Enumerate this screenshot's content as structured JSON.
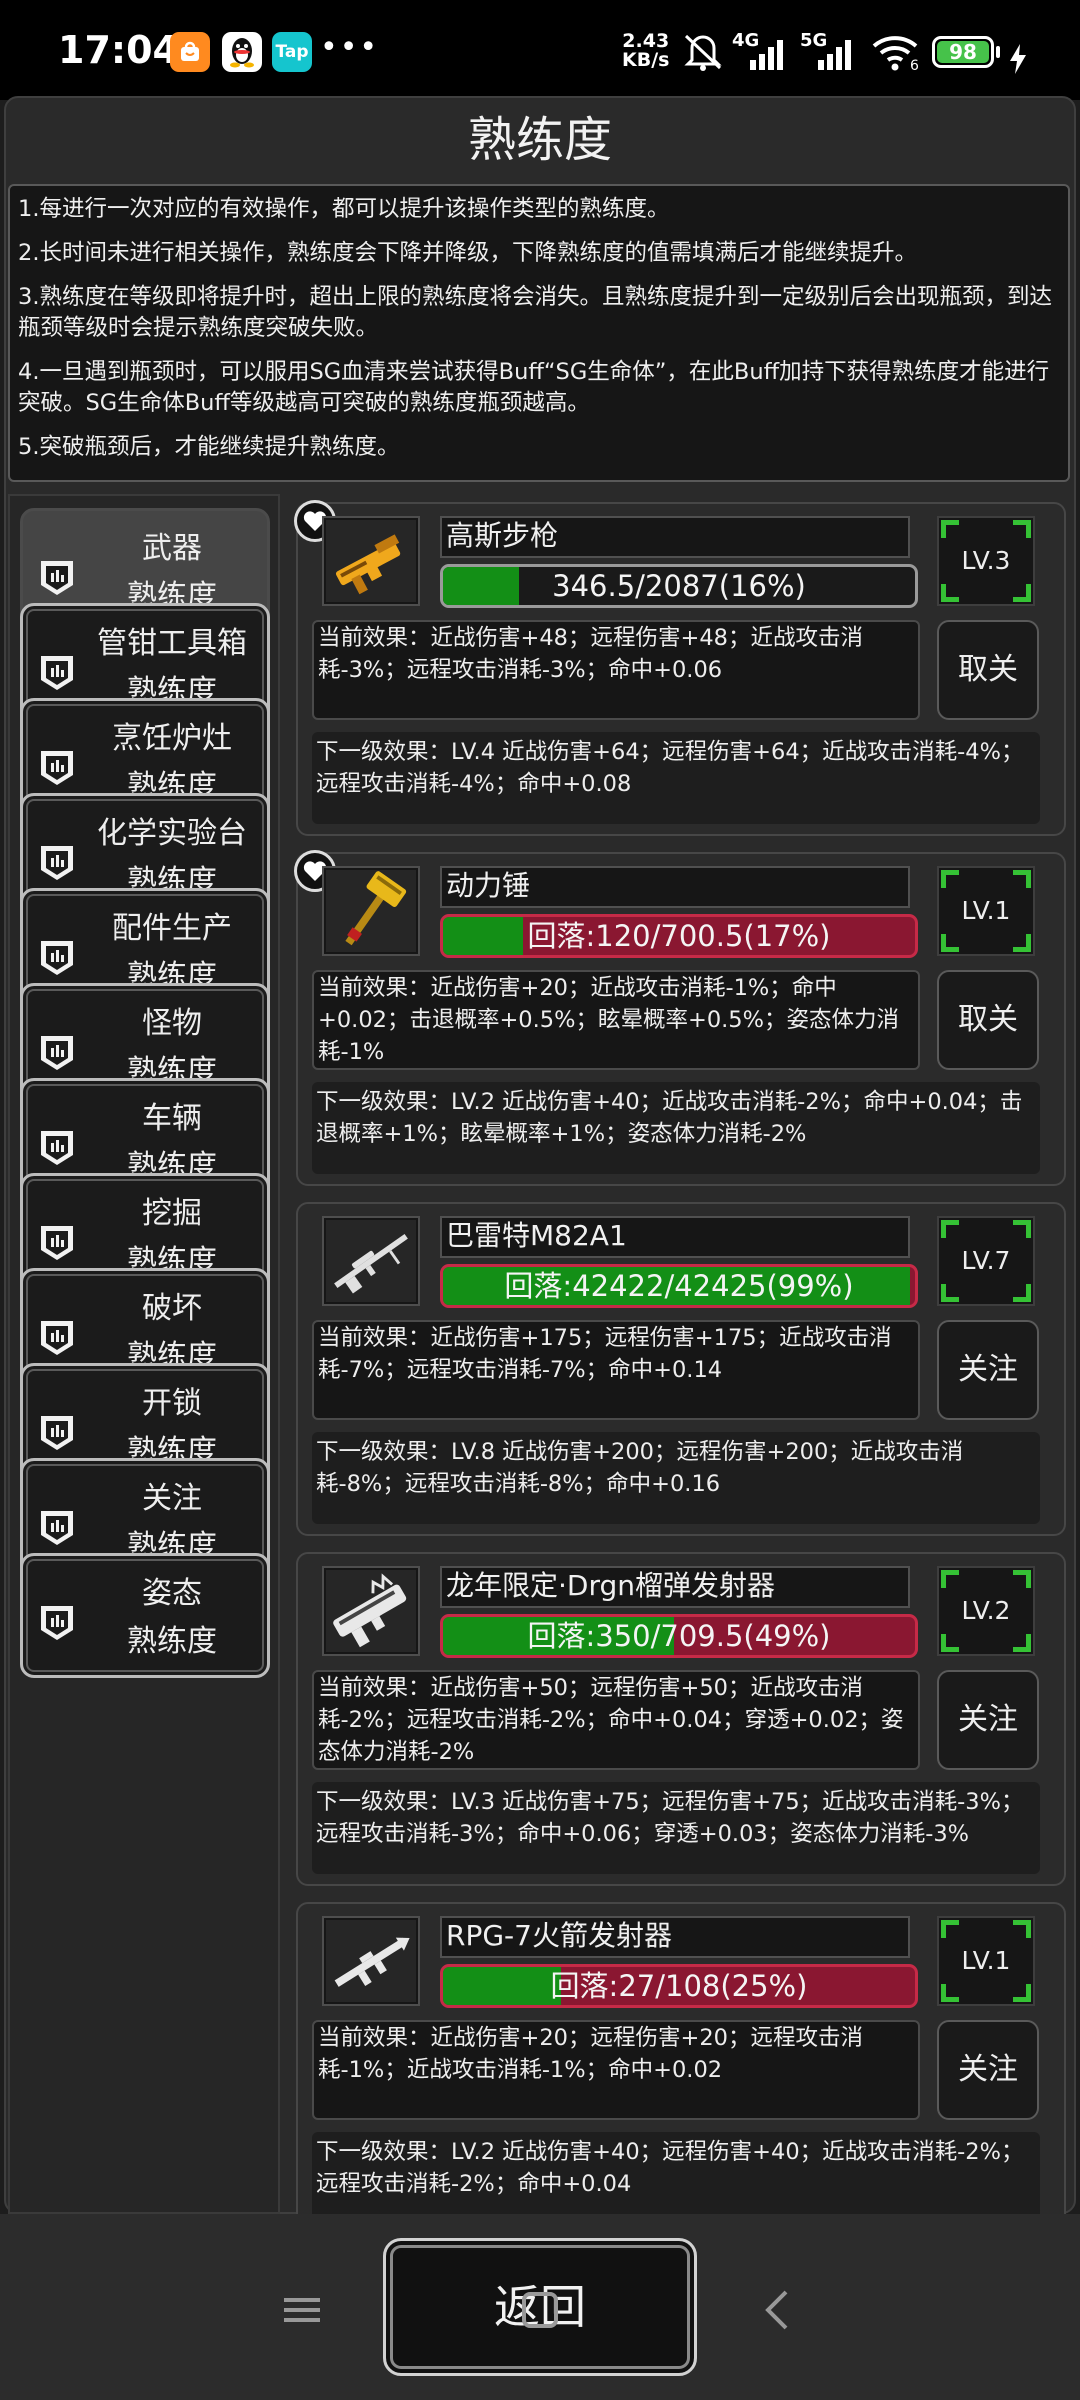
{
  "status_bar": {
    "time": "17:04",
    "app_icons": [
      {
        "name": "mi-store-icon",
        "color": "#ff8a1f",
        "glyph": "🛒"
      },
      {
        "name": "qq-icon",
        "color": "#ffffff",
        "glyph": "🐧"
      },
      {
        "name": "taptap-icon",
        "color": "#15c5ce",
        "glyph": "Tap"
      }
    ],
    "more": "•••",
    "speed_value": "2.43",
    "speed_unit": "KB/s",
    "network_4g": "4G",
    "network_5g": "5G",
    "battery": "98"
  },
  "title": "熟练度",
  "notes": [
    "1.每进行一次对应的有效操作，都可以提升该操作类型的熟练度。",
    "2.长时间未进行相关操作，熟练度会下降并降级，下降熟练度的值需填满后才能继续提升。",
    "3.熟练度在等级即将提升时，超出上限的熟练度将会消失。且熟练度提升到一定级别后会出现瓶颈，到达瓶颈等级时会提示熟练度突破失败。",
    "4.一旦遇到瓶颈时，可以服用SG血清来尝试获得Buff“SG生命体”，在此Buff加持下获得熟练度才能进行突破。SG生命体Buff等级越高可突破的熟练度瓶颈越高。",
    "5.突破瓶颈后，才能继续提升熟练度。"
  ],
  "categories": [
    {
      "name": "武器",
      "suffix": "熟练度",
      "active": true
    },
    {
      "name": "管钳工具箱",
      "suffix": "熟练度"
    },
    {
      "name": "烹饪炉灶",
      "suffix": "熟练度"
    },
    {
      "name": "化学实验台",
      "suffix": "熟练度"
    },
    {
      "name": "配件生产",
      "suffix": "熟练度"
    },
    {
      "name": "怪物",
      "suffix": "熟练度"
    },
    {
      "name": "车辆",
      "suffix": "熟练度"
    },
    {
      "name": "挖掘",
      "suffix": "熟练度"
    },
    {
      "name": "破坏",
      "suffix": "熟练度"
    },
    {
      "name": "开锁",
      "suffix": "熟练度"
    },
    {
      "name": "关注",
      "suffix": "熟练度"
    },
    {
      "name": "姿态",
      "suffix": "熟练度"
    }
  ],
  "weapons": [
    {
      "name": "高斯步枪",
      "progress_text": "346.5/2087(16%)",
      "progress": 0.16,
      "bar_state": "normal",
      "level": "LV.3",
      "favorite": true,
      "current": "当前效果：近战伤害+48；远程伤害+48；近战攻击消耗-3%；远程攻击消耗-3%；命中+0.06",
      "action": "取关",
      "next": "下一级效果：LV.4 近战伤害+64；远程伤害+64；近战攻击消耗-4%；远程攻击消耗-4%；命中+0.08",
      "icon": "gauss-rifle-icon",
      "icon_color": "#f0a81c"
    },
    {
      "name": "动力锤",
      "progress_text": "回落:120/700.5(17%)",
      "progress": 0.17,
      "bar_state": "decline",
      "level": "LV.1",
      "favorite": true,
      "current": "当前效果：近战伤害+20；近战攻击消耗-1%；命中+0.02；击退概率+0.5%；眩晕概率+0.5%；姿态体力消耗-1%",
      "action": "取关",
      "next": "下一级效果：LV.2 近战伤害+40；近战攻击消耗-2%；命中+0.04；击退概率+1%；眩晕概率+1%；姿态体力消耗-2%",
      "icon": "power-hammer-icon",
      "icon_color": "#e8b81a"
    },
    {
      "name": "巴雷特M82A1",
      "progress_text": "回落:42422/42425(99%)",
      "progress": 0.99,
      "bar_state": "decline",
      "level": "LV.7",
      "favorite": false,
      "current": "当前效果：近战伤害+175；远程伤害+175；近战攻击消耗-7%；远程攻击消耗-7%；命中+0.14",
      "action": "关注",
      "next": "下一级效果：LV.8 近战伤害+200；远程伤害+200；近战攻击消耗-8%；远程攻击消耗-8%；命中+0.16",
      "icon": "sniper-rifle-icon",
      "icon_color": "#e0e0e0"
    },
    {
      "name": "龙年限定·Drgn榴弹发射器",
      "progress_text": "回落:350/709.5(49%)",
      "progress": 0.49,
      "bar_state": "decline",
      "level": "LV.2",
      "favorite": false,
      "current": "当前效果：近战伤害+50；远程伤害+50；近战攻击消耗-2%；远程攻击消耗-2%；命中+0.04；穿透+0.02；姿态体力消耗-2%",
      "action": "关注",
      "next": "下一级效果：LV.3 近战伤害+75；远程伤害+75；近战攻击消耗-3%；远程攻击消耗-3%；命中+0.06；穿透+0.03；姿态体力消耗-3%",
      "icon": "dragon-launcher-icon",
      "icon_color": "#e8e8e8"
    },
    {
      "name": "RPG-7火箭发射器",
      "progress_text": "回落:27/108(25%)",
      "progress": 0.25,
      "bar_state": "decline",
      "level": "LV.1",
      "favorite": false,
      "current": "当前效果：近战伤害+20；远程伤害+20；远程攻击消耗-1%；近战攻击消耗-1%；命中+0.02",
      "action": "关注",
      "next": "下一级效果：LV.2 近战伤害+40；远程伤害+40；近战攻击消耗-2%；远程攻击消耗-2%；命中+0.04",
      "icon": "rpg-launcher-icon",
      "icon_color": "#e8e8e8"
    }
  ],
  "back_label": "返回",
  "nav": [
    "menu-icon",
    "home-icon",
    "back-arrow-icon"
  ]
}
